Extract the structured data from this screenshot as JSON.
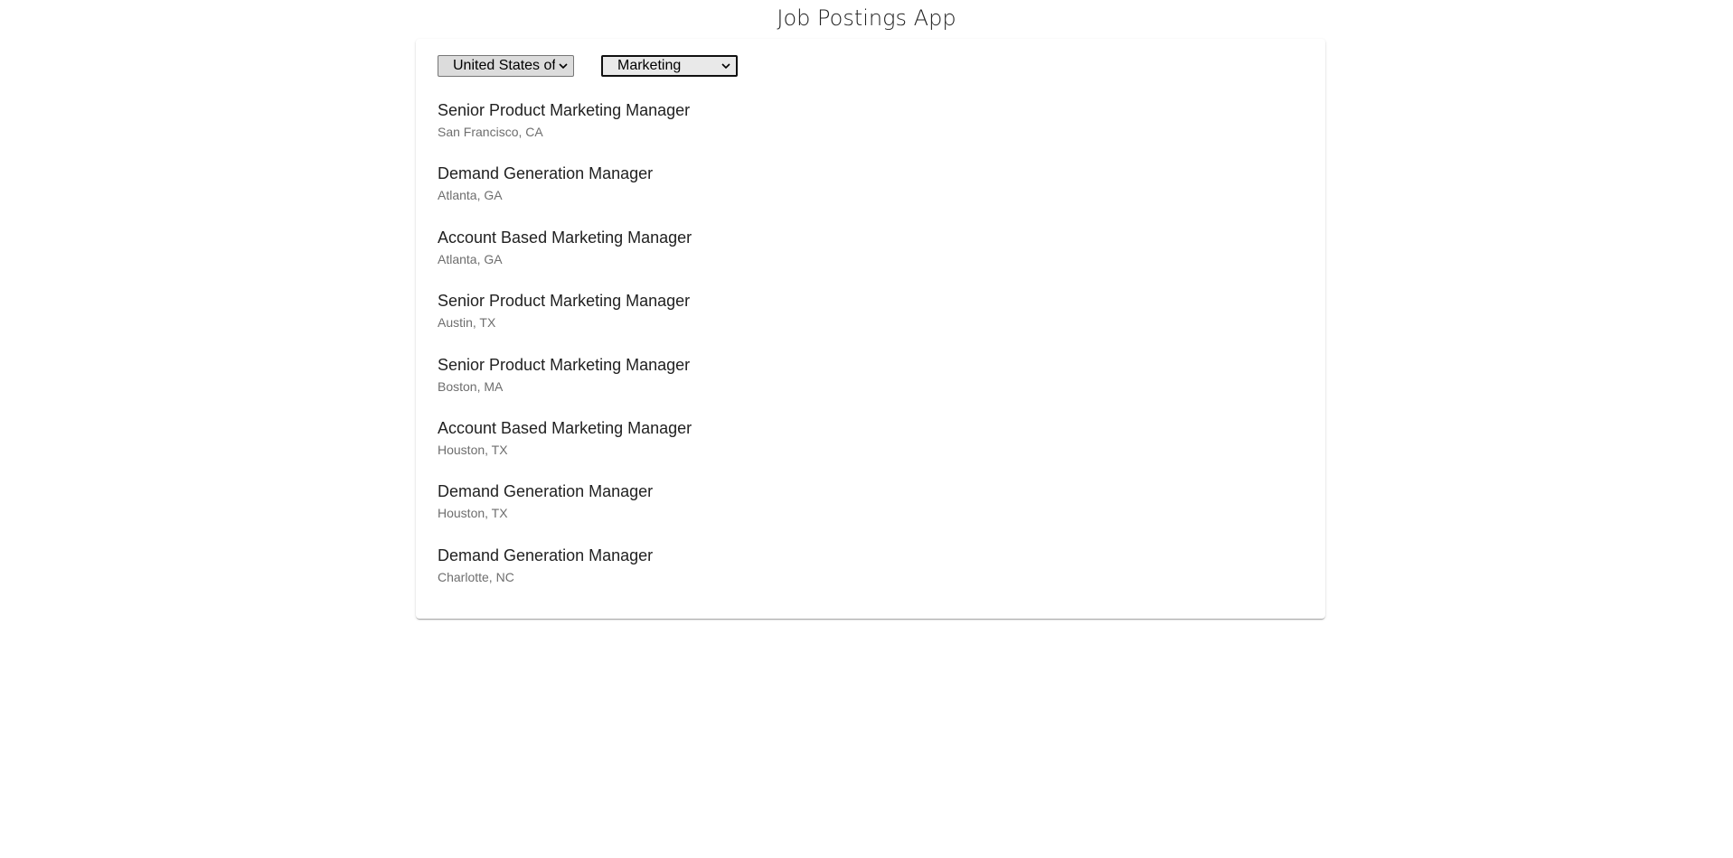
{
  "app": {
    "title": "Job Postings App"
  },
  "filters": {
    "country": {
      "selected": "United States of America",
      "icon": "chevron-down-icon"
    },
    "department": {
      "selected": "Marketing",
      "icon": "chevron-down-icon"
    }
  },
  "jobs": [
    {
      "title": "Senior Product Marketing Manager",
      "location": "San Francisco, CA"
    },
    {
      "title": "Demand Generation Manager",
      "location": "Atlanta, GA"
    },
    {
      "title": "Account Based Marketing Manager",
      "location": "Atlanta, GA"
    },
    {
      "title": "Senior Product Marketing Manager",
      "location": "Austin, TX"
    },
    {
      "title": "Senior Product Marketing Manager",
      "location": "Boston, MA"
    },
    {
      "title": "Account Based Marketing Manager",
      "location": "Houston, TX"
    },
    {
      "title": "Demand Generation Manager",
      "location": "Houston, TX"
    },
    {
      "title": "Demand Generation Manager",
      "location": "Charlotte, NC"
    }
  ]
}
